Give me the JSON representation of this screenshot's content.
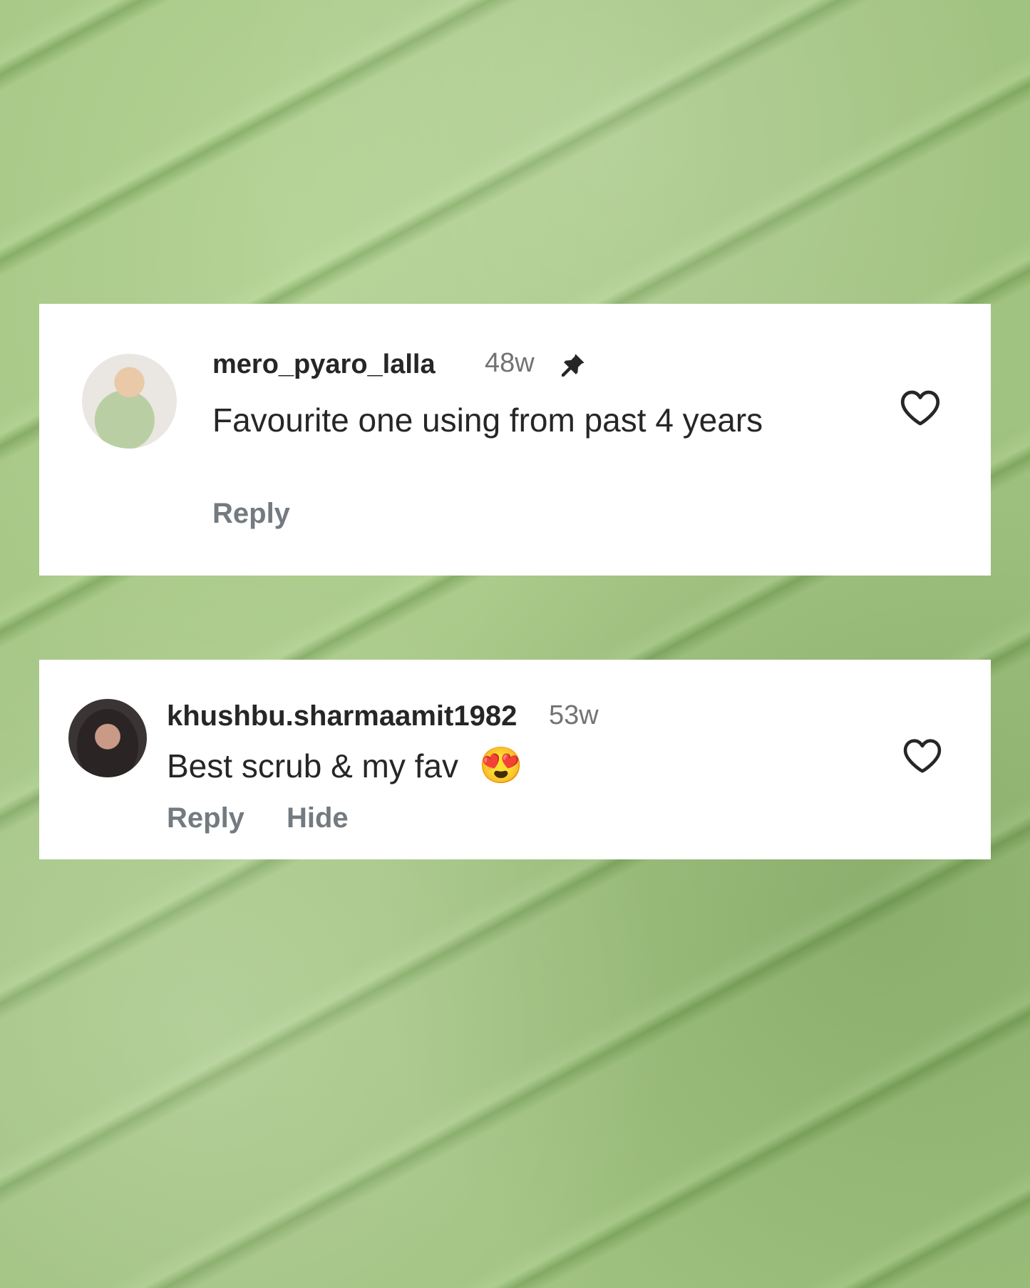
{
  "comments": [
    {
      "username": "mero_pyaro_lalla",
      "time": "48w",
      "pinned": true,
      "text": "Favourite one using from past 4 years",
      "actions": {
        "reply": "Reply"
      },
      "avatar": "profile-photo"
    },
    {
      "username": "khushbu.sharmaamit1982",
      "time": "53w",
      "pinned": false,
      "text": "Best scrub & my fav",
      "emoji": "😍",
      "actions": {
        "reply": "Reply",
        "hide": "Hide"
      },
      "avatar": "profile-photo"
    }
  ],
  "icons": {
    "pin": "pin-icon",
    "like": "heart-outline-icon"
  },
  "colors": {
    "text": "#262626",
    "muted": "#737373",
    "action": "#737a80",
    "card": "#ffffff",
    "background": "#a9c98a"
  }
}
